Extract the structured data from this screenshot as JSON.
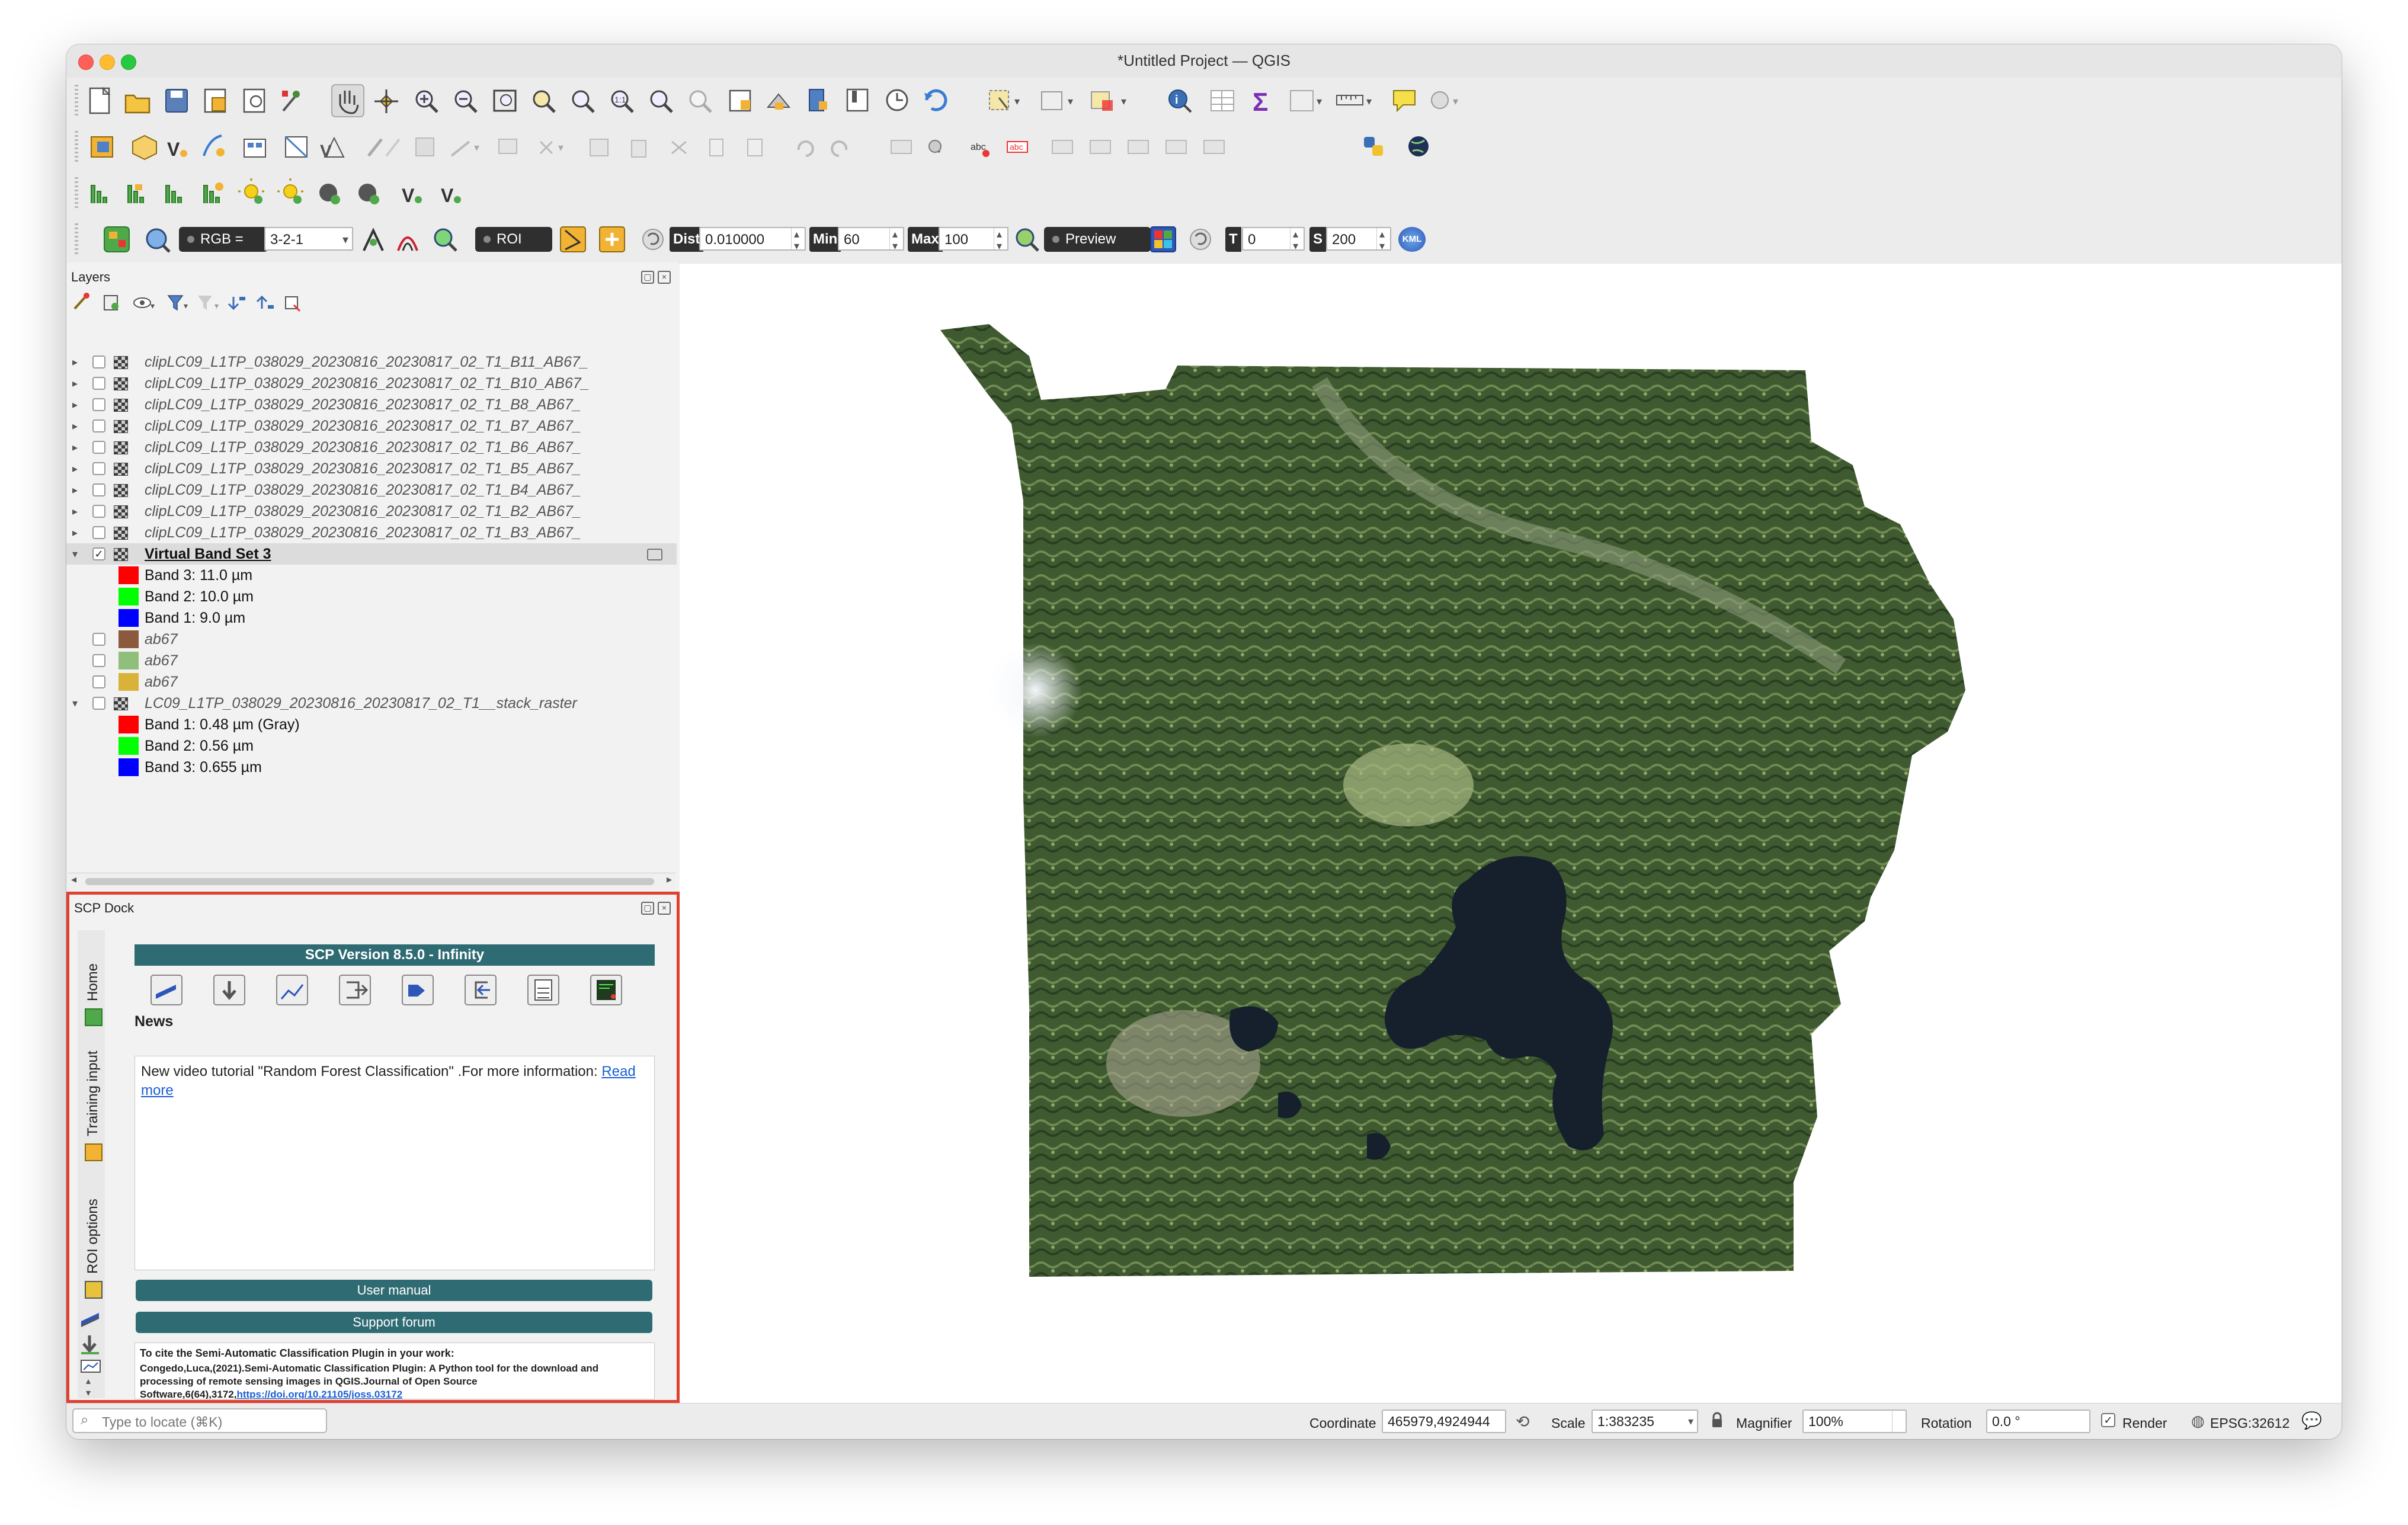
{
  "window": {
    "title": "*Untitled Project — QGIS"
  },
  "scp_toolbar": {
    "rgb_label": "RGB =",
    "rgb_value": "3-2-1",
    "roi_label": "ROI",
    "dist_label": "Dist",
    "dist_value": "0.010000",
    "min_label": "Min",
    "min_value": "60",
    "max_label": "Max",
    "max_value": "100",
    "preview_label": "Preview",
    "t_label": "T",
    "t_value": "0",
    "s_label": "S",
    "s_value": "200",
    "kml_label": "KML"
  },
  "layers_panel": {
    "title": "Layers",
    "layers": [
      {
        "name": "clipLC09_L1TP_038029_20230816_20230817_02_T1_B11_AB67_"
      },
      {
        "name": "clipLC09_L1TP_038029_20230816_20230817_02_T1_B10_AB67_"
      },
      {
        "name": "clipLC09_L1TP_038029_20230816_20230817_02_T1_B8_AB67_"
      },
      {
        "name": "clipLC09_L1TP_038029_20230816_20230817_02_T1_B7_AB67_"
      },
      {
        "name": "clipLC09_L1TP_038029_20230816_20230817_02_T1_B6_AB67_"
      },
      {
        "name": "clipLC09_L1TP_038029_20230816_20230817_02_T1_B5_AB67_"
      },
      {
        "name": "clipLC09_L1TP_038029_20230816_20230817_02_T1_B4_AB67_"
      },
      {
        "name": "clipLC09_L1TP_038029_20230816_20230817_02_T1_B2_AB67_"
      },
      {
        "name": "clipLC09_L1TP_038029_20230816_20230817_02_T1_B3_AB67_"
      }
    ],
    "virtual_band_set": {
      "name": "Virtual Band Set  3",
      "bands": [
        {
          "label": "Band 3: 11.0  µm",
          "color": "#ff0000"
        },
        {
          "label": "Band 2: 10.0  µm",
          "color": "#00ff00"
        },
        {
          "label": "Band 1: 9.0   µm",
          "color": "#0000ff"
        }
      ]
    },
    "vector_layers": [
      {
        "name": "ab67",
        "color": "#8b5a3c"
      },
      {
        "name": "ab67",
        "color": "#8fbf7a"
      },
      {
        "name": "ab67",
        "color": "#d9b23a"
      }
    ],
    "stack_raster": {
      "name": "LC09_L1TP_038029_20230816_20230817_02_T1__stack_raster",
      "bands": [
        {
          "label": "Band 1: 0.48  µm (Gray)",
          "color": "#ff0000"
        },
        {
          "label": "Band 2: 0.56  µm",
          "color": "#00ff00"
        },
        {
          "label": "Band 3: 0.655 µm",
          "color": "#0000ff"
        }
      ]
    }
  },
  "scp_dock": {
    "title": "SCP Dock",
    "tabs": [
      "Home",
      "Training input",
      "ROI options"
    ],
    "version_banner": "SCP Version 8.5.0 - Infinity",
    "news_heading": "News",
    "news_text": "New video tutorial \"Random Forest Classification\" .For more information: ",
    "news_link": "Read more",
    "user_manual": "User manual",
    "support_forum": "Support forum",
    "cite_heading": "To cite the Semi-Automatic Classification Plugin in your work:",
    "cite_text": "Congedo,Luca,(2021).Semi-Automatic Classification Plugin: A Python tool for the download and processing of remote sensing images in QGIS.Journal of Open Source Software,6(64),3172,",
    "cite_link": "https://doi.org/10.21105/joss.03172"
  },
  "statusbar": {
    "locate_placeholder": "Type to locate (⌘K)",
    "coordinate_label": "Coordinate",
    "coordinate_value": "465979,4924944",
    "scale_label": "Scale",
    "scale_value": "1:383235",
    "magnifier_label": "Magnifier",
    "magnifier_value": "100%",
    "rotation_label": "Rotation",
    "rotation_value": "0.0 °",
    "render_label": "Render",
    "crs_label": "EPSG:32612"
  },
  "colors": {
    "scp_teal": "#2f6b73",
    "highlight_border": "#e0402f"
  }
}
